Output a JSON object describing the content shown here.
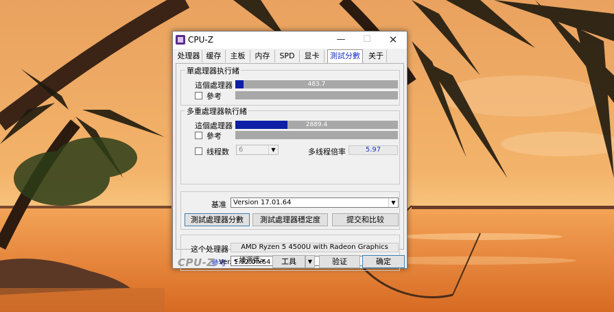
{
  "window": {
    "title": "CPU-Z",
    "minimize_glyph": "—",
    "maximize_glyph": "☐",
    "close_glyph": "✕"
  },
  "tabs": [
    {
      "label": "处理器"
    },
    {
      "label": "缓存"
    },
    {
      "label": "主板"
    },
    {
      "label": "内存"
    },
    {
      "label": "SPD"
    },
    {
      "label": "显卡"
    },
    {
      "label": "測試分數",
      "active": true
    },
    {
      "label": "关于"
    }
  ],
  "single_thread": {
    "title": "單處理器执行緒",
    "this_cpu_label": "這個處理器",
    "this_cpu_score": "483.7",
    "this_cpu_fill": 0.05,
    "reference_label": "參考",
    "reference_checked": false
  },
  "multi_thread": {
    "title": "多重處理器執行緒",
    "this_cpu_label": "這個處理器",
    "this_cpu_score": "2889.4",
    "this_cpu_fill": 0.32,
    "reference_label": "參考",
    "reference_checked": false,
    "threads_label": "线程数",
    "threads_checked": false,
    "threads_value": "6",
    "ratio_label": "多线程倍率",
    "ratio_value": "5.97"
  },
  "benchmark": {
    "label": "基准",
    "version": "Version 17.01.64",
    "btn_bench": "測試處理器分數",
    "btn_stress": "測試處理器穩定度",
    "btn_submit": "提交和比较"
  },
  "processor": {
    "label": "这个处理器",
    "name": "AMD Ryzen 5 4500U with Radeon Graphics",
    "reference_label": "參考",
    "reference_select": "<請選擇>"
  },
  "footer": {
    "logo": "CPU-Z",
    "version": "Ver. 1.92.0.x64",
    "tools_button": "工具",
    "validate_button": "验证",
    "ok_button": "确定"
  },
  "colors": {
    "bar_fill": "#0c1fa6",
    "active_tab": "#1a37c6",
    "reference_link": "#1a37c6"
  }
}
